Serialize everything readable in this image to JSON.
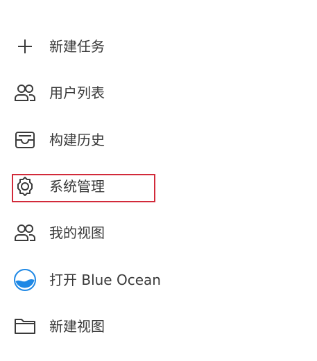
{
  "menu": {
    "items": [
      {
        "label": "新建任务",
        "icon": "plus-icon"
      },
      {
        "label": "用户列表",
        "icon": "users-icon"
      },
      {
        "label": "构建历史",
        "icon": "inbox-tray-icon"
      },
      {
        "label": "系统管理",
        "icon": "gear-icon",
        "highlighted": true
      },
      {
        "label": "我的视图",
        "icon": "users-icon"
      },
      {
        "label": "打开 Blue Ocean",
        "icon": "blue-ocean-icon"
      },
      {
        "label": "新建视图",
        "icon": "folder-icon"
      }
    ]
  },
  "colors": {
    "text": "#3a3a3a",
    "icon": "#3a3a3a",
    "highlight_border": "#d22a3a",
    "blue_ocean": "#1e88e5"
  }
}
